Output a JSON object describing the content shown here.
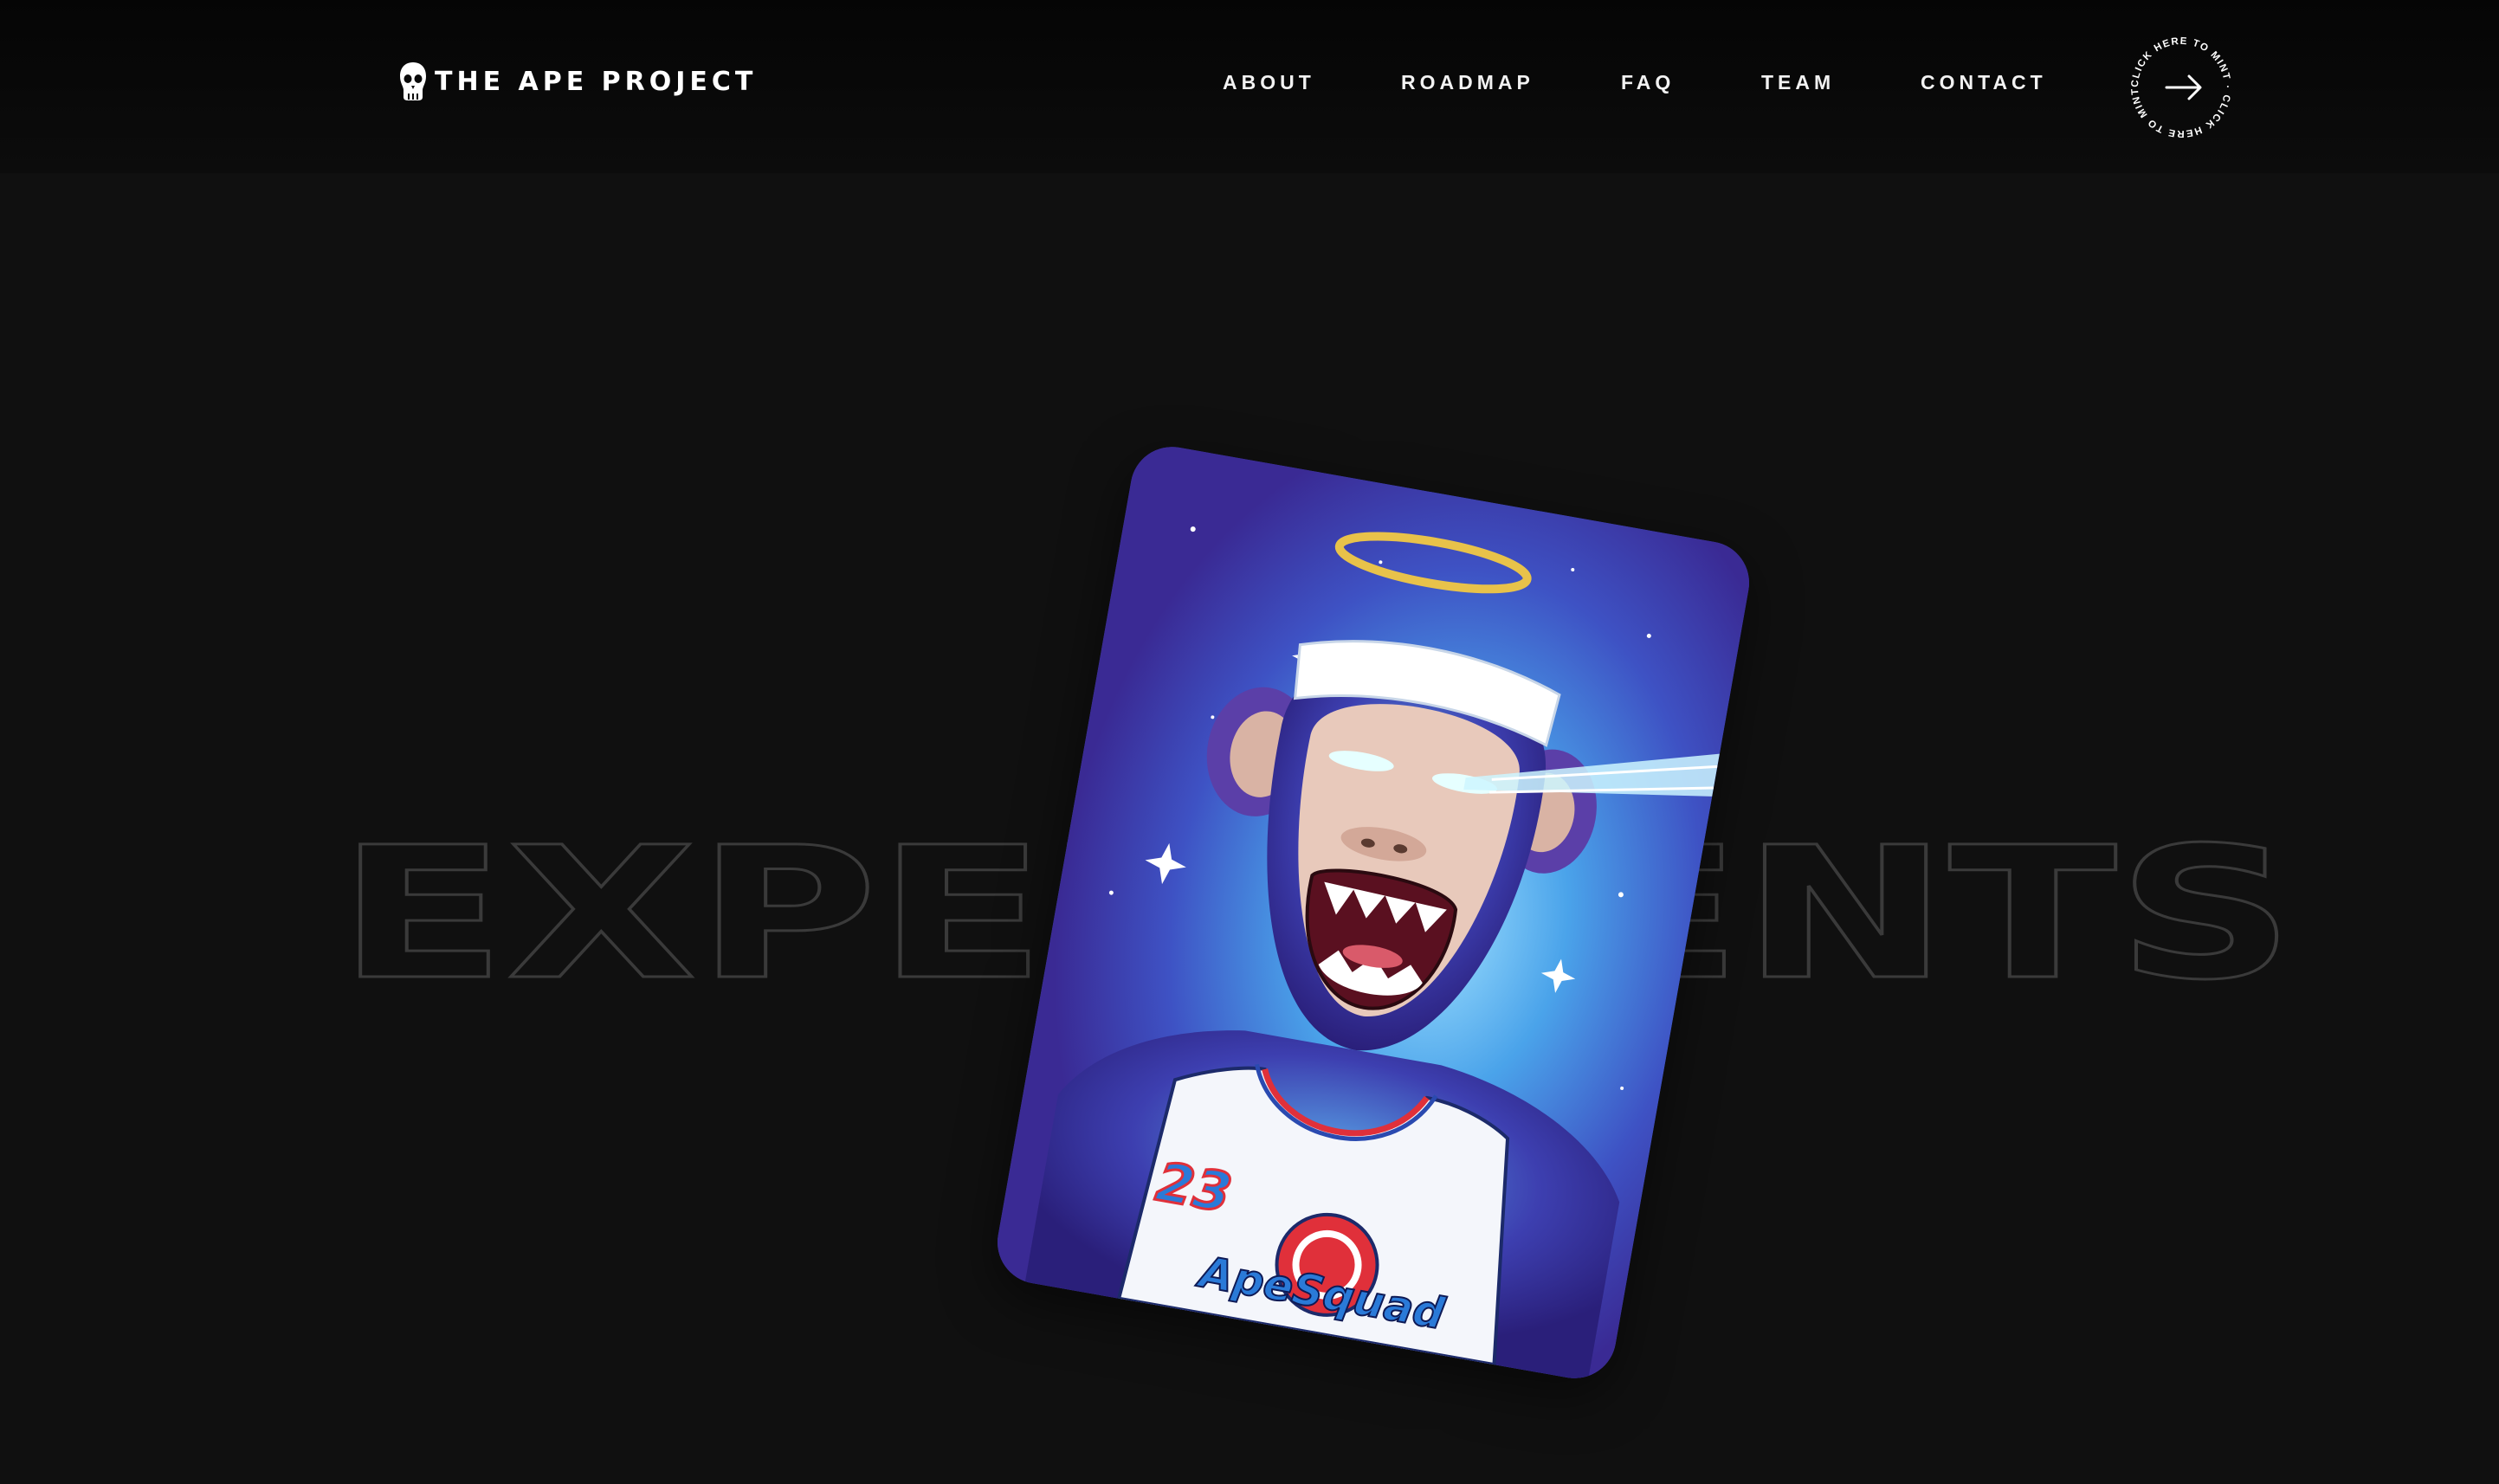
{
  "header": {
    "logo_text": "THE APE PROJECT",
    "logo_icon": "skull-icon"
  },
  "nav": {
    "items": [
      {
        "label": "ABOUT"
      },
      {
        "label": "ROADMAP"
      },
      {
        "label": "FAQ"
      },
      {
        "label": "TEAM"
      },
      {
        "label": "CONTACT"
      }
    ]
  },
  "mint": {
    "ring_text": "CLICK HERE TO MINT · CLICK HERE TO MINT ·",
    "icon": "arrow-right-icon"
  },
  "hero": {
    "background_word": "EXPERIMENTS",
    "card": {
      "jersey_number": "23",
      "jersey_text": "ApeSquad"
    }
  },
  "colors": {
    "background": "#101010",
    "text": "#ffffff",
    "outline": "#3a3a3a",
    "card_blue": "#3f8ee0",
    "card_purple": "#3a2c98",
    "halo": "#e8c24a"
  }
}
